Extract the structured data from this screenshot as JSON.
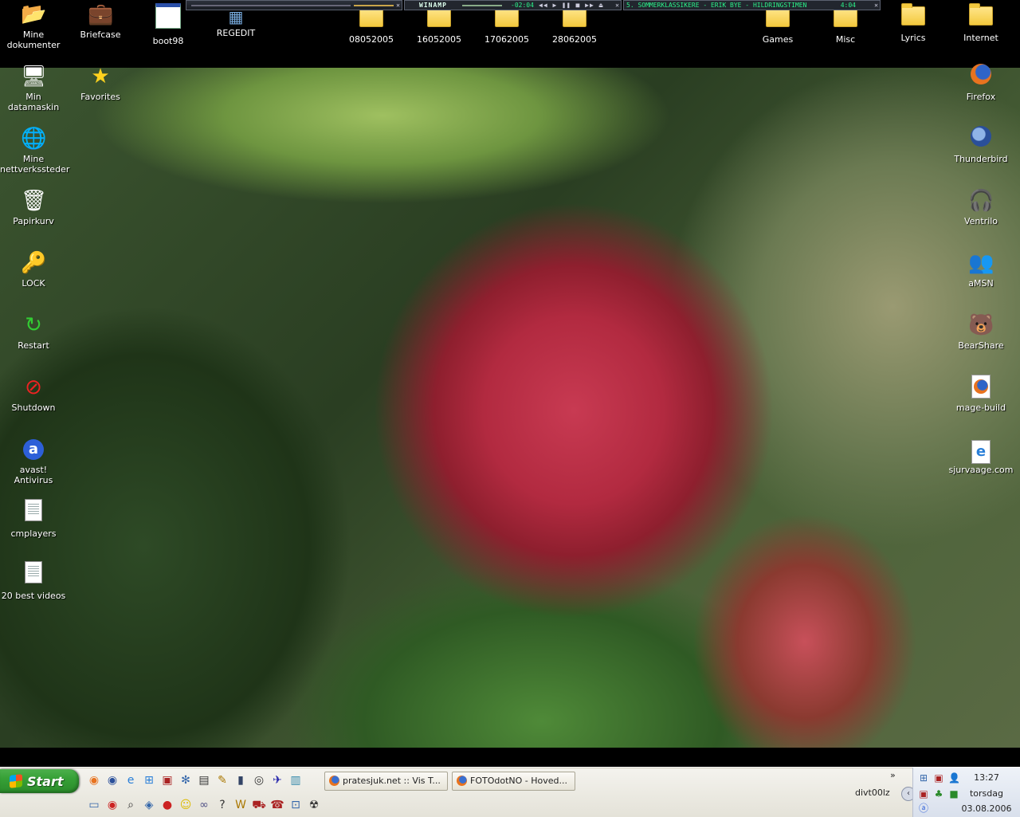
{
  "desktop": {
    "top_icons": [
      {
        "label": "Mine dokumenter",
        "icon": "my-documents-icon"
      },
      {
        "label": "Briefcase",
        "icon": "briefcase-icon"
      },
      {
        "label": "boot98",
        "icon": "window-icon"
      },
      {
        "label": "REGEDIT",
        "icon": "regedit-icon"
      },
      {
        "label": "08052005",
        "icon": "folder-icon"
      },
      {
        "label": "16052005",
        "icon": "folder-icon"
      },
      {
        "label": "17062005",
        "icon": "folder-icon"
      },
      {
        "label": "28062005",
        "icon": "folder-icon"
      },
      {
        "label": "Games",
        "icon": "folder-icon"
      },
      {
        "label": "Misc",
        "icon": "folder-icon"
      },
      {
        "label": "Lyrics",
        "icon": "folder-icon"
      },
      {
        "label": "Internet",
        "icon": "folder-icon"
      }
    ],
    "left_icons": [
      {
        "label": "Min datamaskin",
        "icon": "my-computer-icon"
      },
      {
        "label": "Favorites",
        "icon": "favorites-star-icon"
      },
      {
        "label": "Mine nettverkssteder",
        "icon": "network-places-icon"
      },
      {
        "label": "Papirkurv",
        "icon": "recycle-bin-icon"
      },
      {
        "label": "LOCK",
        "icon": "lock-user-icon"
      },
      {
        "label": "Restart",
        "icon": "restart-arrow-icon"
      },
      {
        "label": "Shutdown",
        "icon": "shutdown-icon"
      },
      {
        "label": "avast! Antivirus",
        "icon": "avast-icon"
      },
      {
        "label": "cmplayers",
        "icon": "text-document-icon"
      },
      {
        "label": "20 best videos",
        "icon": "text-document-icon"
      }
    ],
    "right_icons": [
      {
        "label": "Firefox",
        "icon": "firefox-icon"
      },
      {
        "label": "Thunderbird",
        "icon": "thunderbird-icon"
      },
      {
        "label": "Ventrilo",
        "icon": "ventrilo-icon"
      },
      {
        "label": "aMSN",
        "icon": "amsn-icon"
      },
      {
        "label": "BearShare",
        "icon": "bearshare-icon"
      },
      {
        "label": "mage-build",
        "icon": "firefox-doc-icon"
      },
      {
        "label": "sjurvaage.com",
        "icon": "ie-shortcut-icon"
      }
    ]
  },
  "winamp": {
    "brand": "WINAMP",
    "time": "-02:04",
    "playlist_title": "5. SOMMERKLASSIKERE - ERIK BYE - HILDRINGSTIMEN",
    "playlist_time": "4:04"
  },
  "taskbar": {
    "start_label": "Start",
    "tasks": [
      {
        "label": "pratesjuk.net :: Vis T..."
      },
      {
        "label": "FOTOdotNO - Hoved..."
      }
    ],
    "chevron": "»",
    "user": "divt00lz"
  },
  "clock": {
    "time": "13:27",
    "day": "torsdag",
    "date": "03.08.2006"
  }
}
